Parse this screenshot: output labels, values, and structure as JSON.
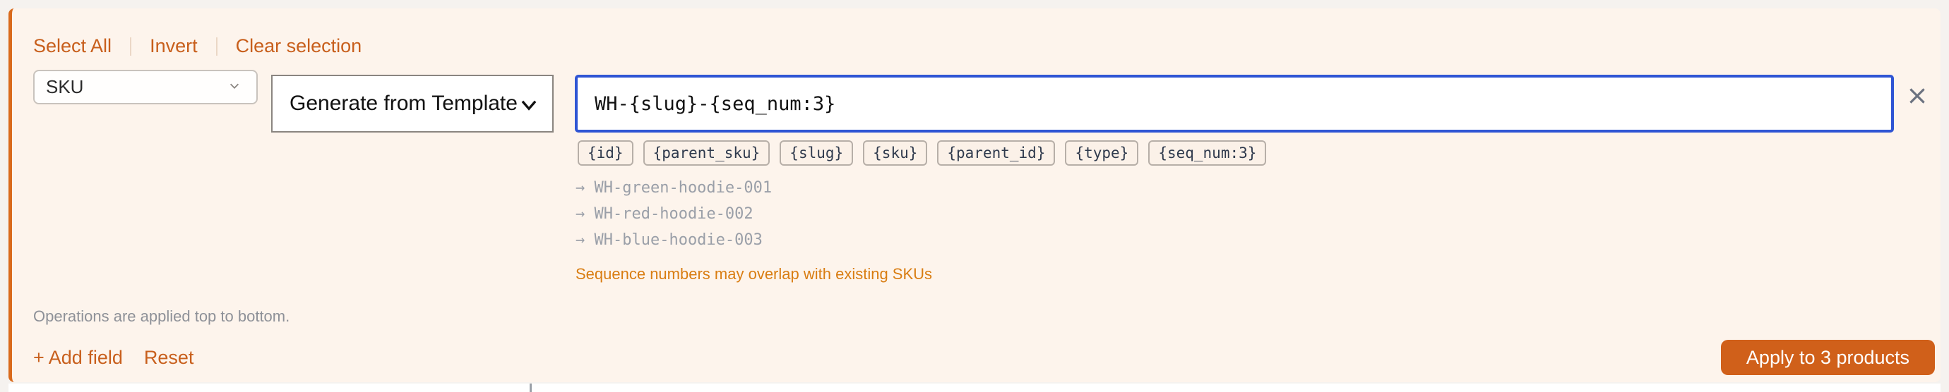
{
  "toolbar": {
    "select_all": "Select All",
    "invert": "Invert",
    "clear_selection": "Clear selection"
  },
  "field_select": {
    "value": "SKU"
  },
  "mode_select": {
    "value": "Generate from Template"
  },
  "template_input": {
    "value": "WH-{slug}-{seq_num:3}"
  },
  "tokens": [
    "{id}",
    "{parent_sku}",
    "{slug}",
    "{sku}",
    "{parent_id}",
    "{type}",
    "{seq_num:3}"
  ],
  "previews": [
    "→ WH-green-hoodie-001",
    "→ WH-red-hoodie-002",
    "→ WH-blue-hoodie-003"
  ],
  "warning": "Sequence numbers may overlap with existing SKUs",
  "note": "Operations are applied top to bottom.",
  "actions": {
    "add_field": "+ Add field",
    "reset": "Reset",
    "apply": "Apply to 3 products"
  },
  "colors": {
    "accent": "#d0601a",
    "focus": "#2f55d4",
    "warning": "#d97d12",
    "panel_bg": "#fdf4ec"
  }
}
